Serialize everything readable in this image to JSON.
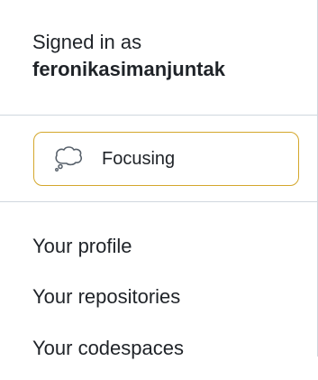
{
  "header": {
    "signed_in_label": "Signed in as",
    "username": "feronikasimanjuntak"
  },
  "status": {
    "label": "Focusing",
    "icon": "thought-bubble-icon",
    "border_color": "#d4a72c"
  },
  "menu_items": [
    {
      "label": "Your profile"
    },
    {
      "label": "Your repositories"
    },
    {
      "label": "Your codespaces"
    }
  ]
}
